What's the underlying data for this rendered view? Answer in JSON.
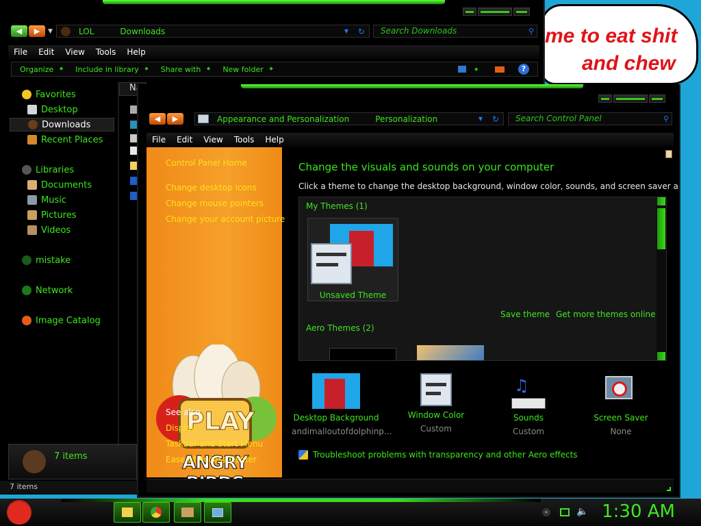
{
  "desktop": {
    "bubble_line1": "me to eat shit",
    "bubble_line2": "and chew"
  },
  "explorer": {
    "address_crumbs": [
      "LOL",
      "Downloads"
    ],
    "search_placeholder": "Search Downloads",
    "menu": [
      "File",
      "Edit",
      "View",
      "Tools",
      "Help"
    ],
    "commands": [
      "Organize",
      "Include in library",
      "Share with",
      "New folder"
    ],
    "column_header": "Na",
    "nav": {
      "favorites": "Favorites",
      "desktop": "Desktop",
      "downloads": "Downloads",
      "recent": "Recent Places",
      "libraries": "Libraries",
      "documents": "Documents",
      "music": "Music",
      "pictures": "Pictures",
      "videos": "Videos",
      "mistake": "mistake",
      "network": "Network",
      "image_catalog": "Image Catalog"
    },
    "details_count": "7 items",
    "status_count": "7 items"
  },
  "control_panel": {
    "address_crumbs": [
      "Appearance and Personalization",
      "Personalization"
    ],
    "search_placeholder": "Search Control Panel",
    "menu": [
      "File",
      "Edit",
      "View",
      "Tools",
      "Help"
    ],
    "sidebar": {
      "home": "Control Panel Home",
      "links": [
        "Change desktop icons",
        "Change mouse pointers",
        "Change your account picture"
      ],
      "see_also": "See also",
      "see_also_links": [
        "Display",
        "Taskbar and Start Menu",
        "Ease of Access Center"
      ],
      "logo_play": "PLAY",
      "logo_text": "ANGRY BIRDS"
    },
    "title": "Change the visuals and sounds on your computer",
    "subtitle": "Click a theme to change the desktop background, window color, sounds, and screen saver all at once.",
    "my_themes_header": "My Themes (1)",
    "unsaved_theme": "Unsaved Theme",
    "save_theme": "Save theme",
    "get_more": "Get more themes online",
    "aero_header": "Aero Themes (2)",
    "bottom": [
      {
        "title": "Desktop Background",
        "value": "andimalloutofdolphinp..."
      },
      {
        "title": "Window Color",
        "value": "Custom"
      },
      {
        "title": "Sounds",
        "value": "Custom"
      },
      {
        "title": "Screen Saver",
        "value": "None"
      }
    ],
    "troubleshoot": "Troubleshoot problems with transparency and other Aero effects"
  },
  "taskbar": {
    "clock": "1:30 AM"
  },
  "colors": {
    "accent_green": "#3ee81e",
    "sidebar_orange": "#f5a02a",
    "link_yellow": "#ffe01a",
    "desktop_blue": "#1fa6d8"
  }
}
